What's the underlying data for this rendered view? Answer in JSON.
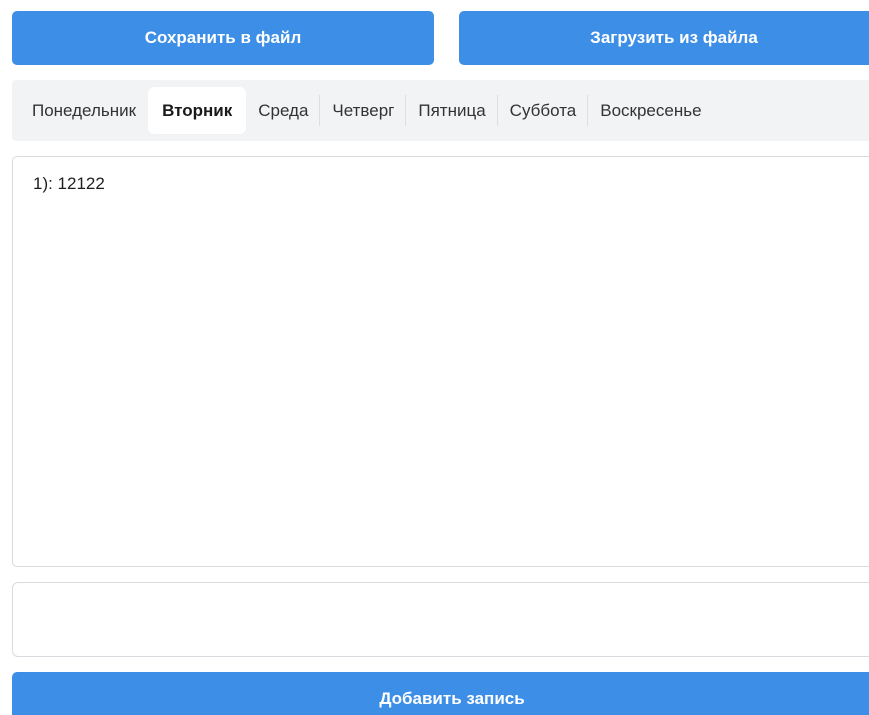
{
  "toolbar": {
    "save_label": "Сохранить в файл",
    "load_label": "Загрузить из файла"
  },
  "tabs": [
    {
      "label": "Понедельник",
      "active": false
    },
    {
      "label": "Вторник",
      "active": true
    },
    {
      "label": "Среда",
      "active": false
    },
    {
      "label": "Четверг",
      "active": false
    },
    {
      "label": "Пятница",
      "active": false
    },
    {
      "label": "Суббота",
      "active": false
    },
    {
      "label": "Воскресенье",
      "active": false
    }
  ],
  "entries": [
    {
      "text": "1): 12122"
    }
  ],
  "input": {
    "value": "",
    "placeholder": ""
  },
  "add_button": {
    "label": "Добавить запись"
  },
  "colors": {
    "accent": "#3d8ee6",
    "tabs_background": "#f1f3f5",
    "border": "#d8dbdf"
  }
}
